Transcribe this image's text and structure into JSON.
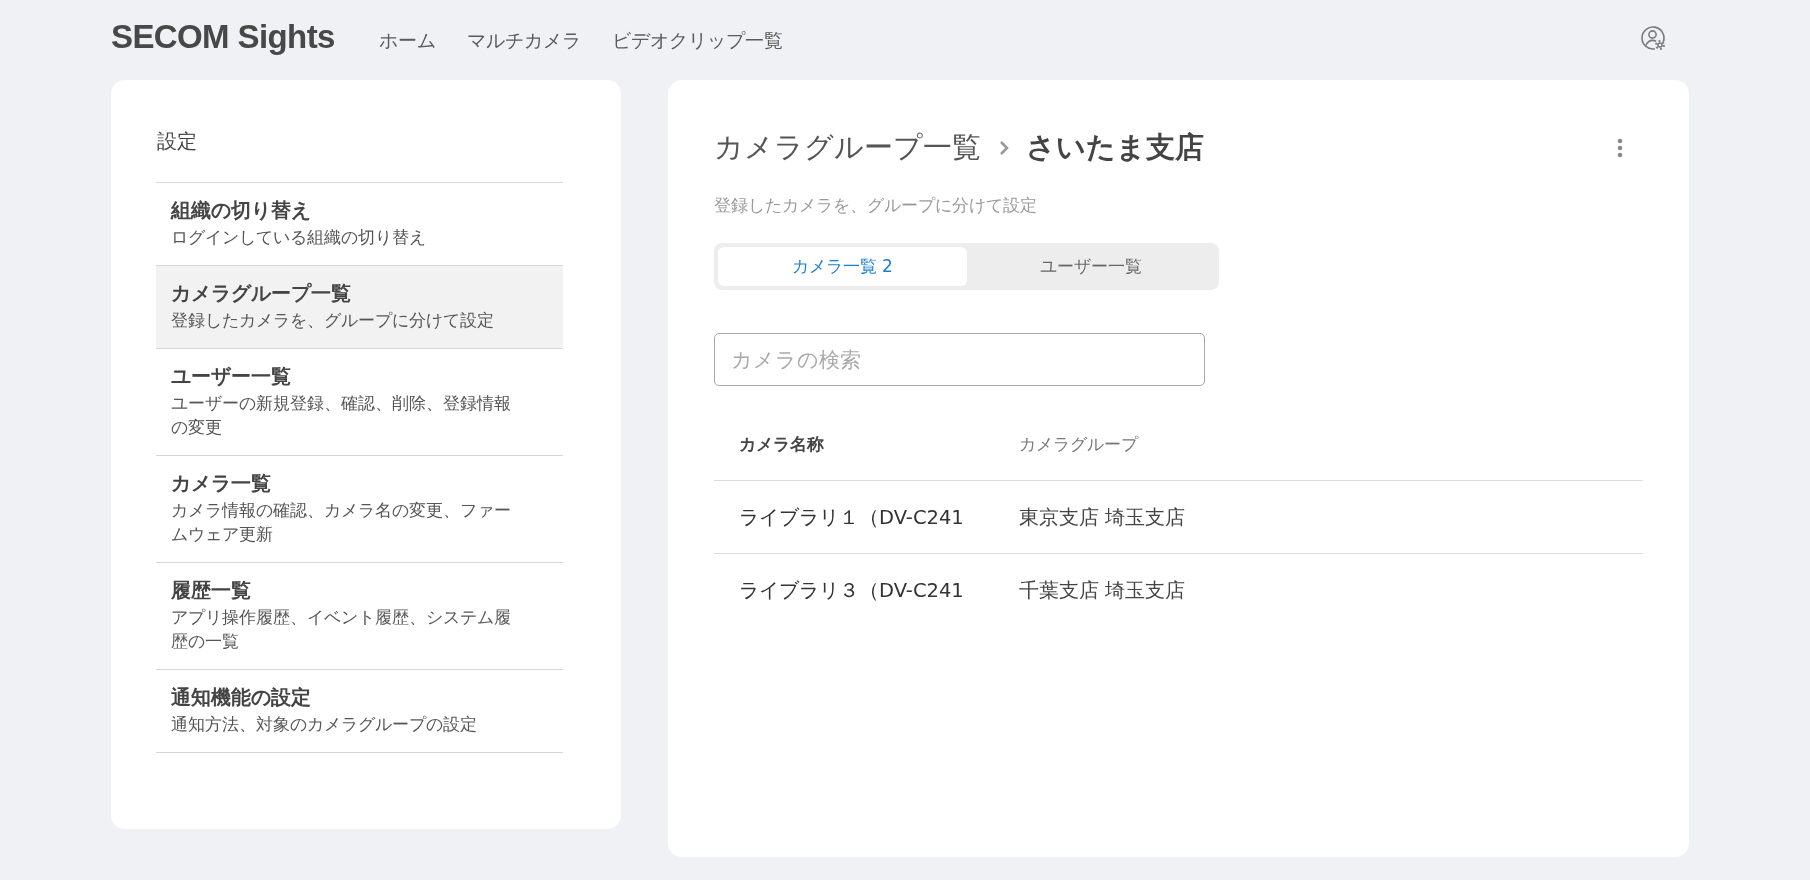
{
  "header": {
    "logo": "SECOM Sights",
    "nav": [
      {
        "label": "ホーム"
      },
      {
        "label": "マルチカメラ"
      },
      {
        "label": "ビデオクリップ一覧"
      }
    ]
  },
  "settings_menu": {
    "title": "設定",
    "items": [
      {
        "title": "組織の切り替え",
        "description": "ログインしている組織の切り替え",
        "selected": false
      },
      {
        "title": "カメラグループ一覧",
        "description": "登録したカメラを、グループに分けて設定",
        "selected": true
      },
      {
        "title": "ユーザー一覧",
        "description": "ユーザーの新規登録、確認、削除、登録情報の変更",
        "selected": false
      },
      {
        "title": "カメラ一覧",
        "description": "カメラ情報の確認、カメラ名の変更、ファームウェア更新",
        "selected": false
      },
      {
        "title": "履歴一覧",
        "description": "アプリ操作履歴、イベント履歴、システム履歴の一覧",
        "selected": false
      },
      {
        "title": "通知機能の設定",
        "description": "通知方法、対象のカメラグループの設定",
        "selected": false
      }
    ]
  },
  "camera_group": {
    "breadcrumb": {
      "parent": "カメラグループ一覧",
      "current": "さいたま支店"
    },
    "description": "登録したカメラを、グループに分けて設定",
    "tabs": [
      {
        "label": "カメラ一覧 2",
        "selected": true
      },
      {
        "label": "ユーザー一覧",
        "selected": false
      }
    ],
    "search": {
      "placeholder": "カメラの検索"
    },
    "table": {
      "columns": [
        "カメラ名称",
        "カメラグループ"
      ],
      "rows": [
        [
          "ライブラリ１（DV-C241",
          "東京支店 埼玉支店"
        ],
        [
          "ライブラリ３（DV-C241",
          "千葉支店 埼玉支店"
        ]
      ]
    }
  }
}
